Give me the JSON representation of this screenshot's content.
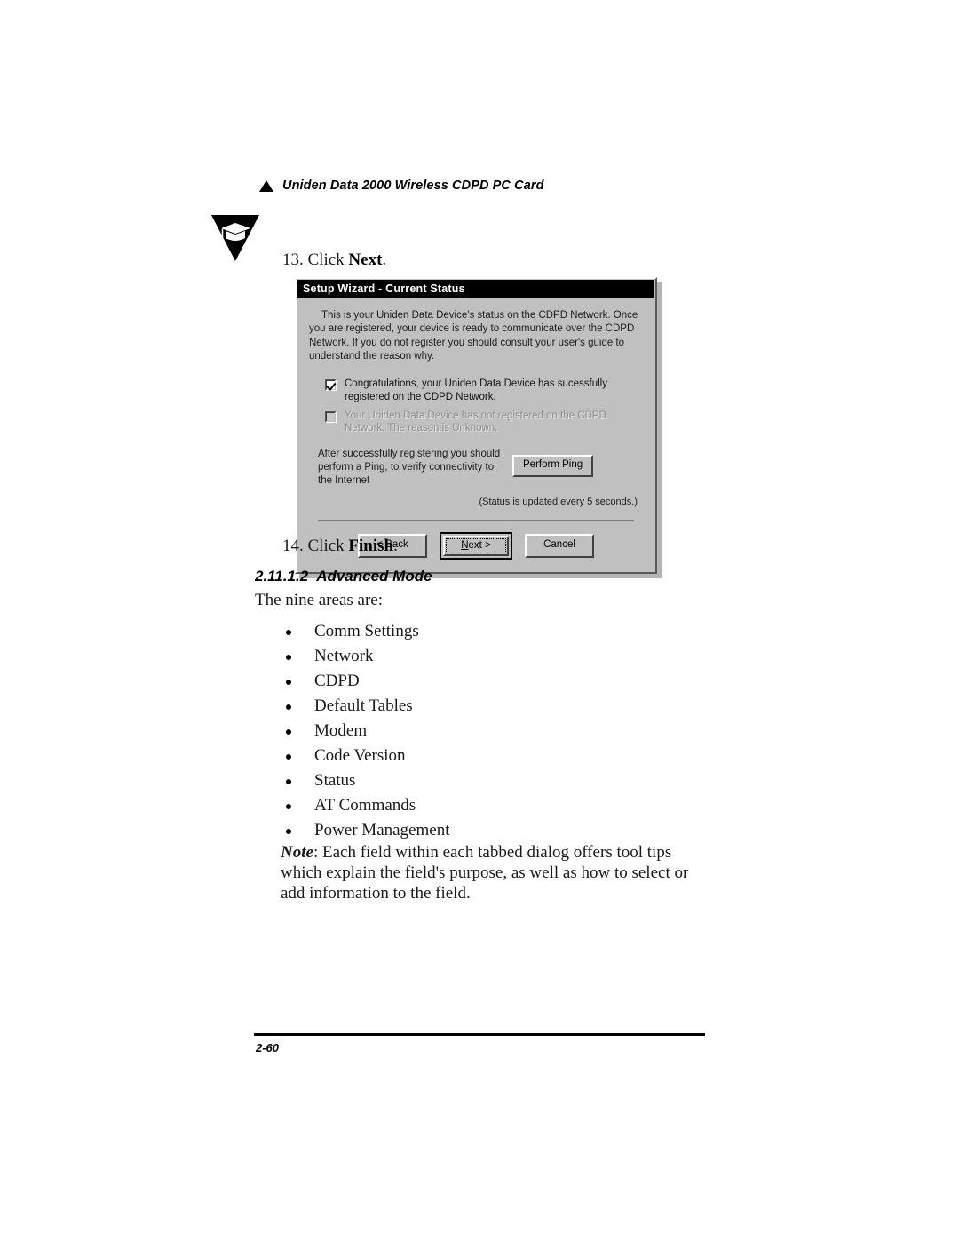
{
  "header": {
    "bullet_icon": "triangle-right-icon",
    "title": "Uniden Data 2000 Wireless CDPD PC Card",
    "marker_icon": "graduation-cap-in-triangle-icon"
  },
  "steps": {
    "step13_prefix": "13. Click ",
    "step13_bold": "Next",
    "step13_suffix": ".",
    "step14_prefix": "14. Click ",
    "step14_bold": "Finish",
    "step14_suffix": "."
  },
  "dialog": {
    "title": "Setup Wizard - Current Status",
    "intro": "This is your Uniden Data Device's status on the CDPD Network. Once you are registered, your device is ready to communicate over the CDPD Network.  If you do not register you should consult your user's guide to understand the reason why.",
    "checkboxes": [
      {
        "checked": true,
        "enabled": true,
        "label": "Congratulations, your Uniden Data Device has sucessfully registered on the CDPD Network."
      },
      {
        "checked": false,
        "enabled": false,
        "label": "Your Uniden Data Device has not registered on the CDPD Network. The  reason is Unknown."
      }
    ],
    "ping_text": "After successfully registering you should perform a Ping, to verify connectivity to the Internet",
    "ping_button": "Perform Ping",
    "status_note": "(Status is updated every 5 seconds.)",
    "buttons": {
      "back": "< Back",
      "next_pre": "N",
      "next_post": "ext >",
      "cancel": "Cancel"
    },
    "colors": {
      "face": "#c0c0c0",
      "titlebar": "#000000",
      "titlebar_text": "#ffffff",
      "disabled_text": "#8e8e8e"
    }
  },
  "section": {
    "number": "2.11.1.2",
    "title": "Advanced Mode",
    "lead_in": "The nine areas are:",
    "items": [
      "Comm Settings",
      "Network",
      "CDPD",
      "Default Tables",
      "Modem",
      "Code Version",
      "Status",
      "AT Commands",
      "Power Management"
    ]
  },
  "note": {
    "label": "Note",
    "text": ": Each field within each tabbed dialog offers tool tips which explain the field's purpose, as well as how to select or add information to the field."
  },
  "footer": {
    "page_number": "2-60"
  }
}
